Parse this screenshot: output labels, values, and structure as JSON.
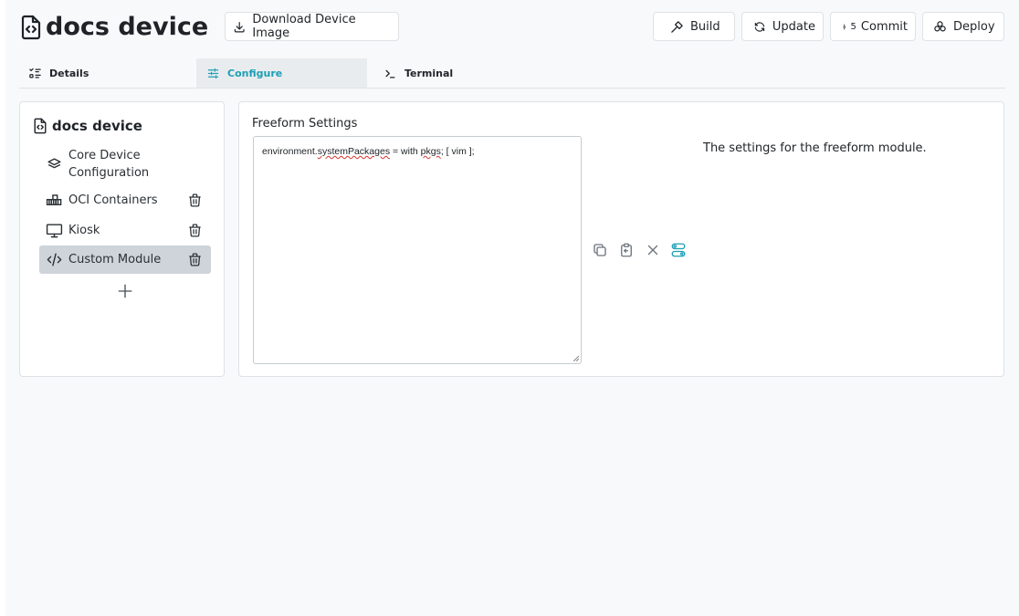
{
  "device": {
    "title": "docs device"
  },
  "header": {
    "download_label": "Download Device Image",
    "build_label": "Build",
    "update_label": "Update",
    "commit_count": "5",
    "commit_label": "Commit",
    "deploy_label": "Deploy"
  },
  "tabs": [
    {
      "label": "Details",
      "icon": "list-details-icon",
      "active": false
    },
    {
      "label": "Configure",
      "icon": "adjustments-icon",
      "active": true
    },
    {
      "label": "Terminal",
      "icon": "terminal-icon",
      "active": false
    }
  ],
  "sidebar": {
    "title": "docs device",
    "items": [
      {
        "label": "Core Device Configuration",
        "icon": "layers-icon",
        "deletable": false,
        "selected": false
      },
      {
        "label": "OCI Containers",
        "icon": "containers-icon",
        "deletable": true,
        "selected": false
      },
      {
        "label": "Kiosk",
        "icon": "monitor-icon",
        "deletable": true,
        "selected": false
      },
      {
        "label": "Custom Module",
        "icon": "code-icon",
        "deletable": true,
        "selected": true
      }
    ]
  },
  "main": {
    "field_label": "Freeform Settings",
    "editor_value": {
      "p1": "environment.",
      "p2": "systemPackages",
      "p3": " = with ",
      "p4": "pkgs",
      "p5": "; [ vim ];"
    },
    "description": "The settings for the freeform module."
  },
  "colors": {
    "accent": "#1c9fb5",
    "selected_bg": "#ced4da",
    "active_tab_bg": "#e9ecef",
    "page_bg": "#f8f9fa",
    "border": "#dee2e6",
    "spellcheck": "#d9342b"
  }
}
